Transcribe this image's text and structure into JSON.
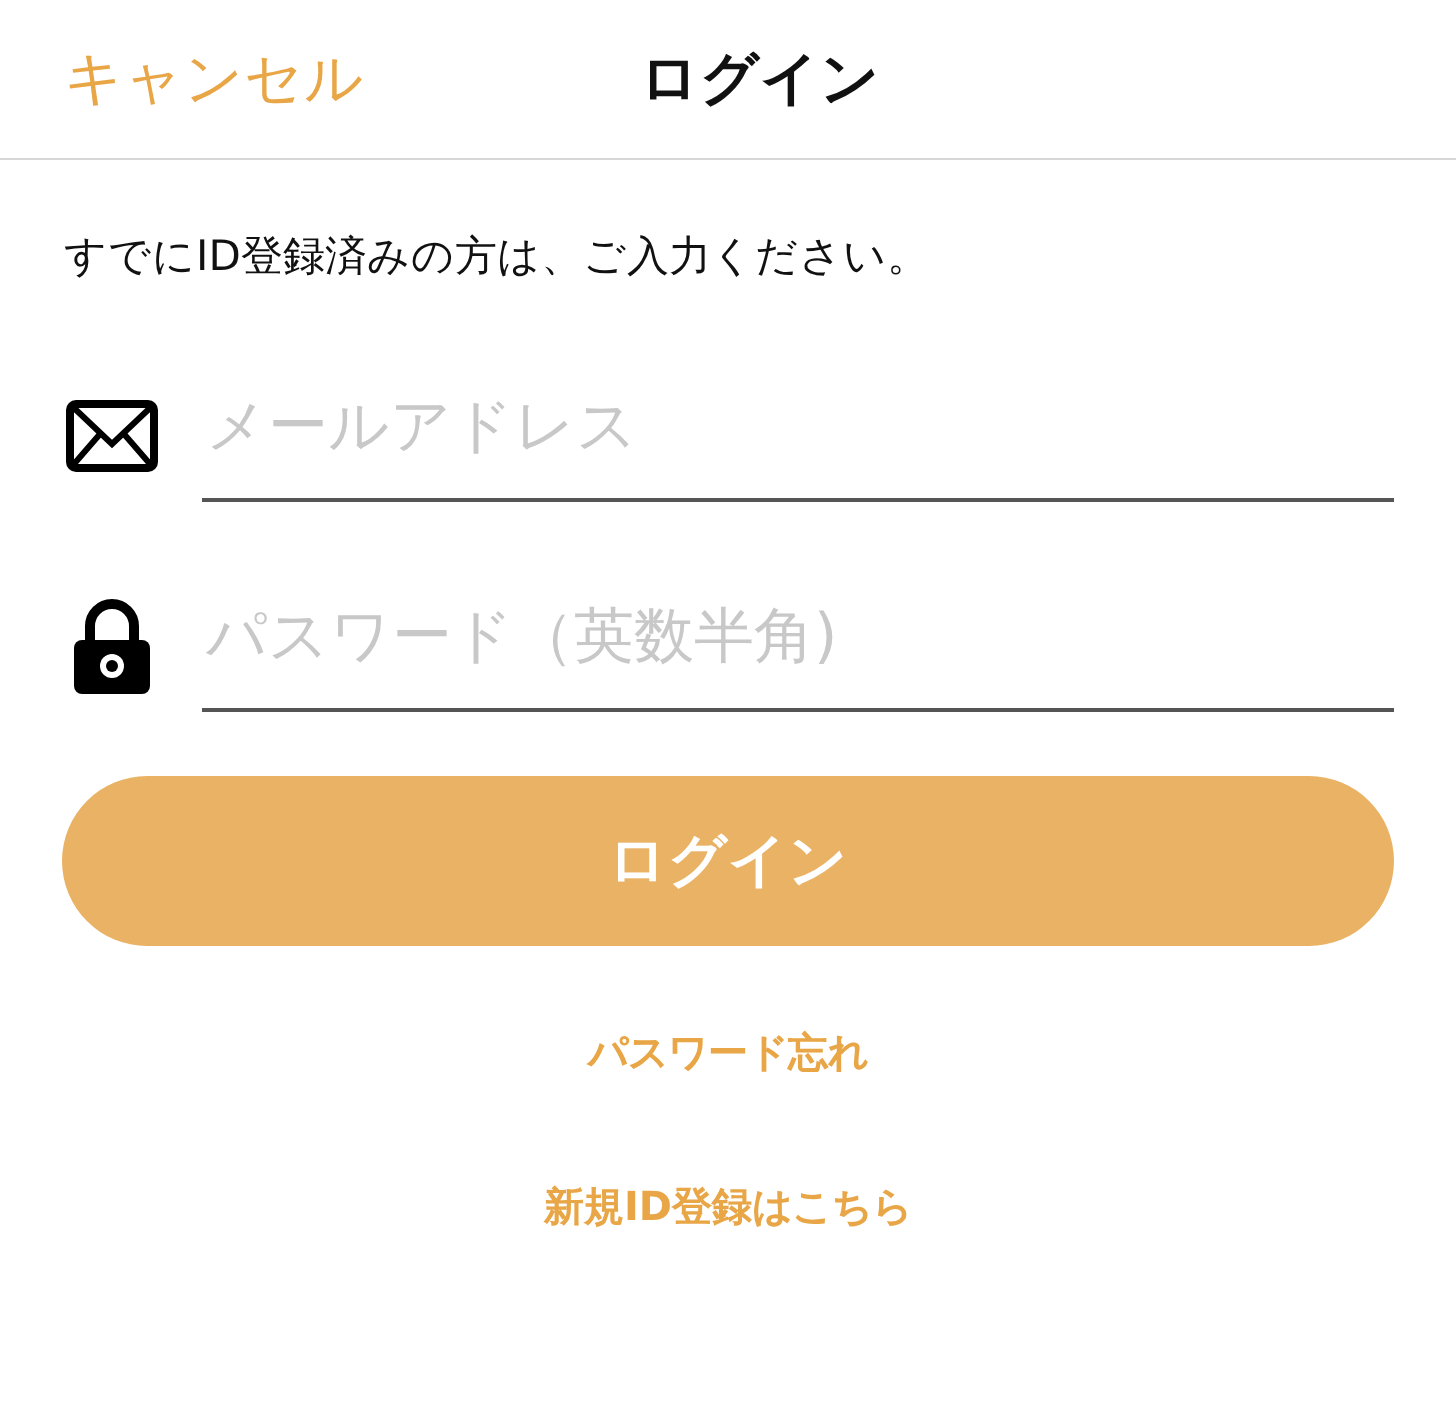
{
  "header": {
    "cancel": "キャンセル",
    "title": "ログイン"
  },
  "intro": "すでにID登録済みの方は、ご入力ください。",
  "fields": [
    {
      "kind": "email",
      "placeholder": "メールアドレス"
    },
    {
      "kind": "password",
      "placeholder": "パスワード（英数半角)"
    }
  ],
  "login_button": "ログイン",
  "links": [
    "パスワード忘れ",
    "新規ID登録はこちら"
  ]
}
